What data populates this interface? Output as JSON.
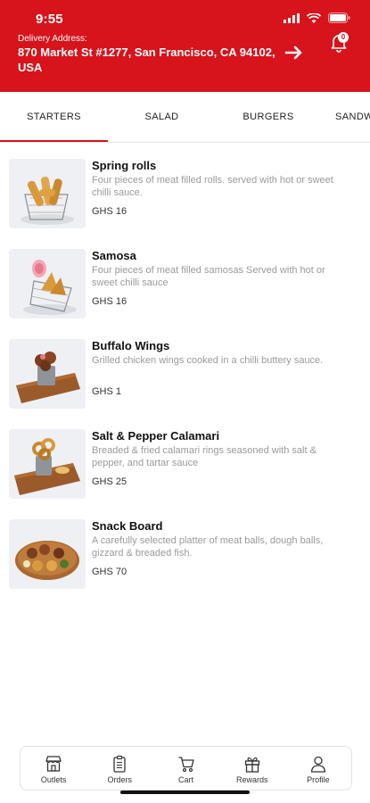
{
  "status_bar": {
    "time": "9:55"
  },
  "header": {
    "delivery_label": "Delivery Address:",
    "address": "870 Market St #1277, San Francisco, CA 94102, USA",
    "notification_count": "0",
    "background_color": "#d7131b"
  },
  "tabs": {
    "items": [
      {
        "label": "STARTERS"
      },
      {
        "label": "SALAD"
      },
      {
        "label": "BURGERS"
      },
      {
        "label": "SANDWICHES"
      }
    ],
    "selected": "STARTERS",
    "accent_color": "#d7131b"
  },
  "menu": {
    "items": [
      {
        "name": "Spring rolls",
        "description": "Four pieces of meat filled rolls. served with hot or sweet chilli sauce.",
        "price": "GHS 16",
        "icon": "spring-rolls-image"
      },
      {
        "name": "Samosa",
        "description": "Four pieces of meat filled samosas Served with hot or sweet chilli sauce",
        "price": "GHS 16",
        "icon": "samosa-image"
      },
      {
        "name": "Buffalo Wings",
        "description": "Grilled chicken wings cooked in a chilli buttery sauce.",
        "price": "GHS 1",
        "icon": "buffalo-wings-image"
      },
      {
        "name": "Salt & Pepper Calamari",
        "description": "Breaded & fried calamari rings seasoned with salt & pepper, and tartar sauce",
        "price": "GHS 25",
        "icon": "calamari-image"
      },
      {
        "name": "Snack Board",
        "description": "A carefully selected platter of meat balls, dough balls, gizzard & breaded fish.",
        "price": "GHS 70",
        "icon": "snack-board-image"
      }
    ]
  },
  "bottom_nav": {
    "items": [
      {
        "label": "Outlets",
        "icon": "store-icon"
      },
      {
        "label": "Orders",
        "icon": "clipboard-icon"
      },
      {
        "label": "Cart",
        "icon": "cart-icon"
      },
      {
        "label": "Rewards",
        "icon": "gift-icon"
      },
      {
        "label": "Profile",
        "icon": "person-icon"
      }
    ]
  }
}
